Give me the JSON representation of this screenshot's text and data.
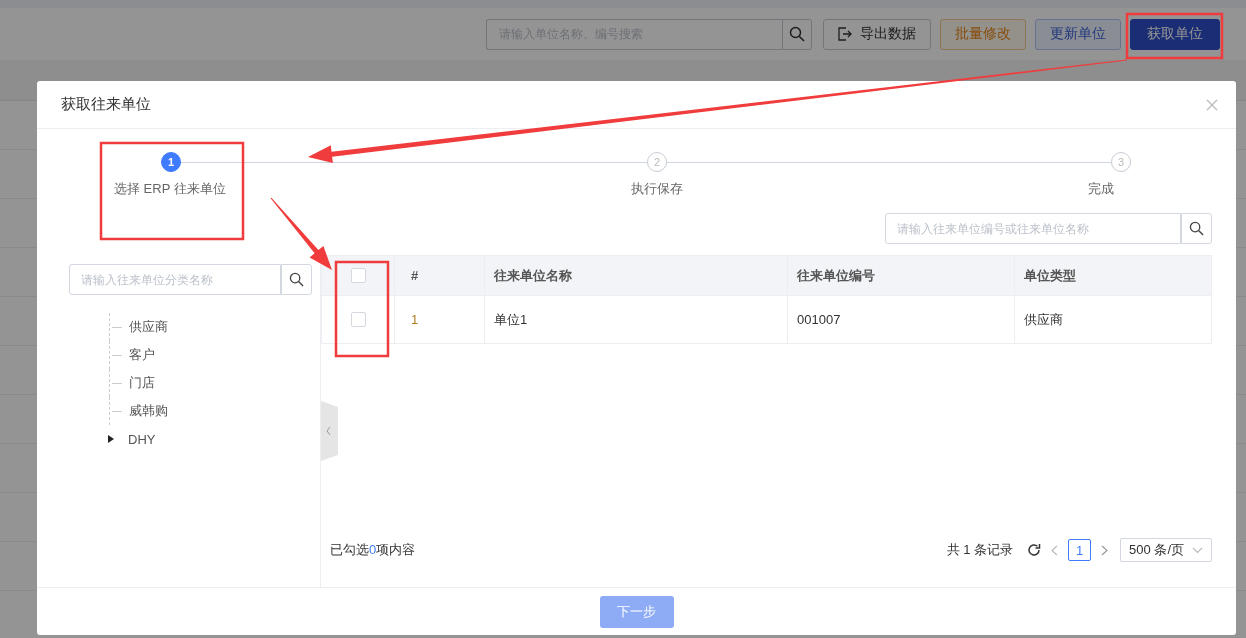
{
  "toolbar": {
    "search": {
      "placeholder": "请输入单位名称、编号搜索"
    },
    "buttons": [
      {
        "label": "导出数据",
        "kind": "export"
      },
      {
        "label": "批量修改",
        "kind": "warning"
      },
      {
        "label": "更新单位",
        "kind": "secondary"
      },
      {
        "label": "获取单位",
        "kind": "primary"
      }
    ]
  },
  "dialog": {
    "title": "获取往来单位",
    "steps": [
      {
        "number": "1",
        "label": "选择 ERP 往来单位",
        "active": true
      },
      {
        "number": "2",
        "label": "执行保存",
        "active": false
      },
      {
        "number": "3",
        "label": "完成",
        "active": false
      }
    ],
    "search": {
      "placeholder": "请输入往来单位编号或往来单位名称"
    },
    "category_search": {
      "placeholder": "请输入往来单位分类名称"
    },
    "tree": [
      {
        "label": "供应商",
        "kind": "leaf"
      },
      {
        "label": "客户",
        "kind": "leaf"
      },
      {
        "label": "门店",
        "kind": "leaf"
      },
      {
        "label": "威韩购",
        "kind": "leaf"
      },
      {
        "label": "DHY",
        "kind": "folder",
        "expanded": false
      }
    ],
    "table": {
      "select_all_checked": false,
      "columns": [
        "#",
        "往来单位名称",
        "往来单位编号",
        "单位类型"
      ],
      "rows": [
        {
          "checked": false,
          "index": "1",
          "name": "单位1",
          "code": "001007",
          "type": "供应商"
        }
      ]
    },
    "selection_summary": {
      "prefix": "已勾选",
      "count": "0",
      "suffix": "项内容"
    },
    "pagination": {
      "total": "共 1 条记录",
      "pages": [
        {
          "label": "1",
          "selected": true
        }
      ],
      "page_size": "500 条/页"
    },
    "next_button": {
      "label": "下一步",
      "disabled": true
    }
  },
  "annotations": [
    {
      "kind": "frame"
    },
    {
      "kind": "frame"
    },
    {
      "kind": "frame"
    },
    {
      "kind": "arrow"
    },
    {
      "kind": "arrow"
    }
  ]
}
